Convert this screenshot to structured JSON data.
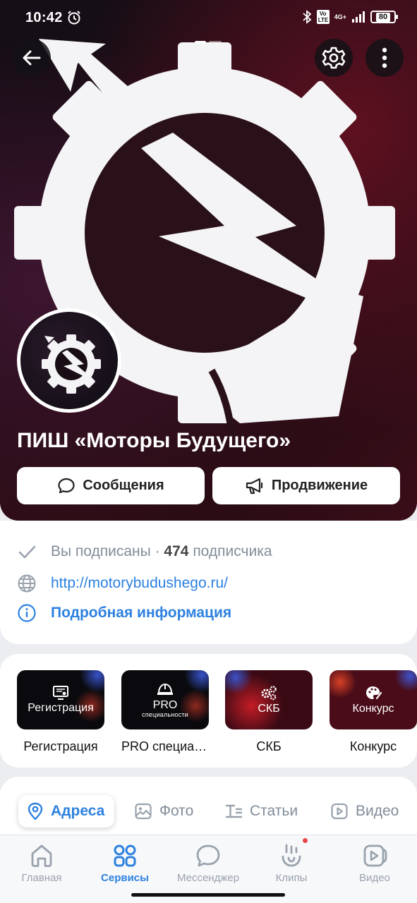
{
  "status_bar": {
    "time": "10:42",
    "battery": "80",
    "network": "4G+",
    "volte": "Vo LTE"
  },
  "header": {
    "back_icon": "arrow-left-icon",
    "settings_icon": "gear-icon",
    "more_icon": "more-vertical-icon",
    "pager": {
      "count": 2,
      "active": 0
    }
  },
  "group": {
    "name": "ПИШ «Моторы Будущего»",
    "messages_label": "Сообщения",
    "promote_label": "Продвижение"
  },
  "info": {
    "subscribed_text": "Вы подписаны ·",
    "subscribers_count": "474",
    "subscribers_word": "подписчика",
    "website": "http://motorybudushego.ru/",
    "details_label": "Подробная информация"
  },
  "services": [
    {
      "tile_text": "Регистрация",
      "label": "Регистрация",
      "icon": "certificate-icon"
    },
    {
      "tile_text": "PRO",
      "tile_sub": "специальности",
      "label": "PRO специаль...",
      "icon": "helmet-icon"
    },
    {
      "tile_text": "СКБ",
      "label": "СКБ",
      "icon": "gears-icon"
    },
    {
      "tile_text": "Конкурс",
      "label": "Конкурс",
      "icon": "palette-icon"
    }
  ],
  "tabs": [
    {
      "label": "Адреса",
      "icon": "location-pin-icon",
      "active": true
    },
    {
      "label": "Фото",
      "icon": "photo-icon",
      "active": false
    },
    {
      "label": "Статьи",
      "icon": "article-icon",
      "active": false
    },
    {
      "label": "Видео",
      "icon": "video-icon",
      "active": false
    }
  ],
  "bottom_nav": [
    {
      "label": "Главная",
      "icon": "home-icon",
      "active": false
    },
    {
      "label": "Сервисы",
      "icon": "services-grid-icon",
      "active": true
    },
    {
      "label": "Мессенджер",
      "icon": "chat-bubble-icon",
      "active": false
    },
    {
      "label": "Клипы",
      "icon": "clips-icon",
      "active": false,
      "badge": true
    },
    {
      "label": "Видео",
      "icon": "video-play-icon",
      "active": false
    }
  ],
  "colors": {
    "accent": "#2d81e0",
    "muted": "#818c99",
    "badge": "#e64646",
    "hero_dark": "#140e16",
    "hero_red": "#5e1020"
  }
}
